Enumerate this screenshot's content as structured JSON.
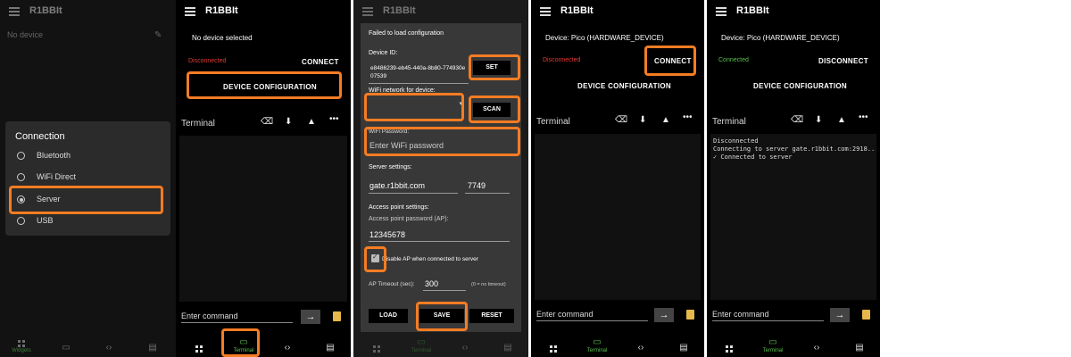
{
  "app_title": "R1BBIt",
  "colors": {
    "highlight": "#f57c23",
    "connected": "#5cbf4e",
    "disconnected": "#e53935",
    "terminal_tab": "#5cbf4e"
  },
  "nav_labels": {
    "widgets": "Widgets",
    "terminal": "Terminal"
  },
  "common": {
    "terminal_label": "Terminal",
    "command_placeholder": "Enter command",
    "send_arrow": "→",
    "more": "•••",
    "clear": "⌫",
    "down": "⬇",
    "up": "▲"
  },
  "screen1": {
    "no_device": "No device",
    "dialog_title": "Connection",
    "options": [
      "Bluetooth",
      "WiFi Direct",
      "Server",
      "USB"
    ],
    "selected_index": 2
  },
  "screen2": {
    "no_device": "No device selected",
    "status": "Disconnected",
    "connect": "CONNECT",
    "device_config": "DEVICE CONFIGURATION"
  },
  "screen3": {
    "failed": "Failed to load configuration",
    "device_id_label": "Device ID:",
    "device_id_value": "e8486239-eb45-440a-8b80-774930e07539",
    "set": "SET",
    "wifi_network_label": "WiFi network for device:",
    "scan": "SCAN",
    "wifi_password_label": "WiFi Password:",
    "wifi_password_placeholder": "Enter WiFi password",
    "server_settings_label": "Server settings:",
    "server_host": "gate.r1bbit.com",
    "server_port": "7749",
    "ap_settings_label": "Access point settings:",
    "ap_password_label": "Access point password (AP):",
    "ap_password_value": "12345678",
    "disable_ap_label": "Disable AP when connected to server",
    "disable_ap_checked": true,
    "ap_timeout_label": "AP Timeout (sec):",
    "ap_timeout_value": "300",
    "ap_timeout_hint": "(0 = no timeout)",
    "load": "LOAD",
    "save": "SAVE",
    "reset": "RESET"
  },
  "screen4": {
    "device": "Device: Pico (HARDWARE_DEVICE)",
    "status": "Disconnected",
    "connect": "CONNECT",
    "device_config": "DEVICE CONFIGURATION"
  },
  "screen5": {
    "device": "Device: Pico (HARDWARE_DEVICE)",
    "status": "Connected",
    "disconnect": "DISCONNECT",
    "device_config": "DEVICE CONFIGURATION",
    "log": [
      "Disconnected",
      "Connecting to server gate.r1bbit.com:2918...",
      "✓ Connected to server"
    ]
  }
}
